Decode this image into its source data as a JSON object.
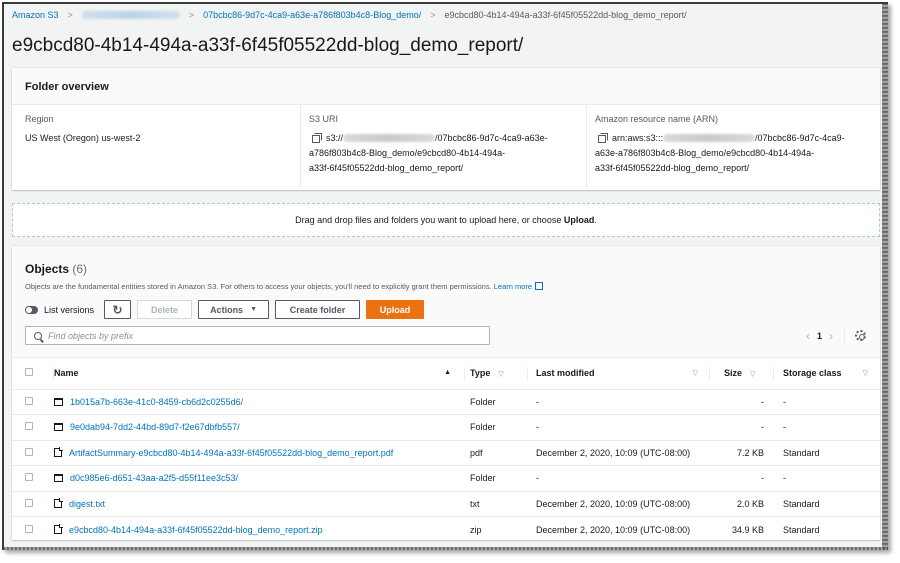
{
  "breadcrumb": {
    "root": "Amazon S3",
    "bucket_redacted": true,
    "parent": "07bcbc86-9d7c-4ca9-a63e-a786f803b4c8-Blog_demo/",
    "current": "e9cbcd80-4b14-494a-a33f-6f45f05522dd-blog_demo_report/"
  },
  "page_title": "e9cbcd80-4b14-494a-a33f-6f45f05522dd-blog_demo_report/",
  "overview": {
    "title": "Folder overview",
    "region_label": "Region",
    "region_value": "US West (Oregon) us-west-2",
    "s3uri_label": "S3 URI",
    "s3uri_prefix": "s3://",
    "s3uri_line1_suffix": "/07bcbc86-9d7c-4ca9-a63e-",
    "s3uri_line2": "a786f803b4c8-Blog_demo/e9cbcd80-4b14-494a-",
    "s3uri_line3": "a33f-6f45f05522dd-blog_demo_report/",
    "arn_label": "Amazon resource name (ARN)",
    "arn_prefix": "arn:aws:s3:::",
    "arn_line1_suffix": "/07bcbc86-9d7c-4ca9-",
    "arn_line2": "a63e-a786f803b4c8-Blog_demo/e9cbcd80-4b14-494a-",
    "arn_line3": "a33f-6f45f05522dd-blog_demo_report/"
  },
  "dropzone": {
    "text": "Drag and drop files and folders you want to upload here, or choose ",
    "bold": "Upload",
    "end": "."
  },
  "objects": {
    "title": "Objects",
    "count": "(6)",
    "description": "Objects are the fundamental entities stored in Amazon S3. For others to access your objects, you'll need to explicitly grant them permissions. ",
    "learn_more": "Learn more",
    "toolbar": {
      "list_versions": "List versions",
      "delete": "Delete",
      "actions": "Actions",
      "create_folder": "Create folder",
      "upload": "Upload"
    },
    "search_placeholder": "Find objects by prefix",
    "pagination": {
      "page": "1"
    },
    "columns": {
      "name": "Name",
      "type": "Type",
      "last_modified": "Last modified",
      "size": "Size",
      "storage_class": "Storage class"
    },
    "rows": [
      {
        "icon": "folder",
        "name": "1b015a7b-663e-41c0-8459-cb6d2c0255d6/",
        "type": "Folder",
        "last_modified": "-",
        "size": "-",
        "storage_class": "-"
      },
      {
        "icon": "folder",
        "name": "9e0dab94-7dd2-44bd-89d7-f2e67dbfb557/",
        "type": "Folder",
        "last_modified": "-",
        "size": "-",
        "storage_class": "-"
      },
      {
        "icon": "file",
        "name": "ArtifactSummary-e9cbcd80-4b14-494a-a33f-6f45f05522dd-blog_demo_report.pdf",
        "type": "pdf",
        "last_modified": "December 2, 2020, 10:09 (UTC-08:00)",
        "size": "7.2 KB",
        "storage_class": "Standard"
      },
      {
        "icon": "folder",
        "name": "d0c985e6-d651-43aa-a2f5-d55f11ee3c53/",
        "type": "Folder",
        "last_modified": "-",
        "size": "-",
        "storage_class": "-"
      },
      {
        "icon": "file",
        "name": "digest.txt",
        "type": "txt",
        "last_modified": "December 2, 2020, 10:09 (UTC-08:00)",
        "size": "2.0 KB",
        "storage_class": "Standard"
      },
      {
        "icon": "file",
        "name": "e9cbcd80-4b14-494a-a33f-6f45f05522dd-blog_demo_report.zip",
        "type": "zip",
        "last_modified": "December 2, 2020, 10:09 (UTC-08:00)",
        "size": "34.9 KB",
        "storage_class": "Standard"
      }
    ]
  },
  "colors": {
    "link": "#0073bb",
    "primary_button": "#ec7211",
    "page_bg": "#f2f3f3"
  }
}
